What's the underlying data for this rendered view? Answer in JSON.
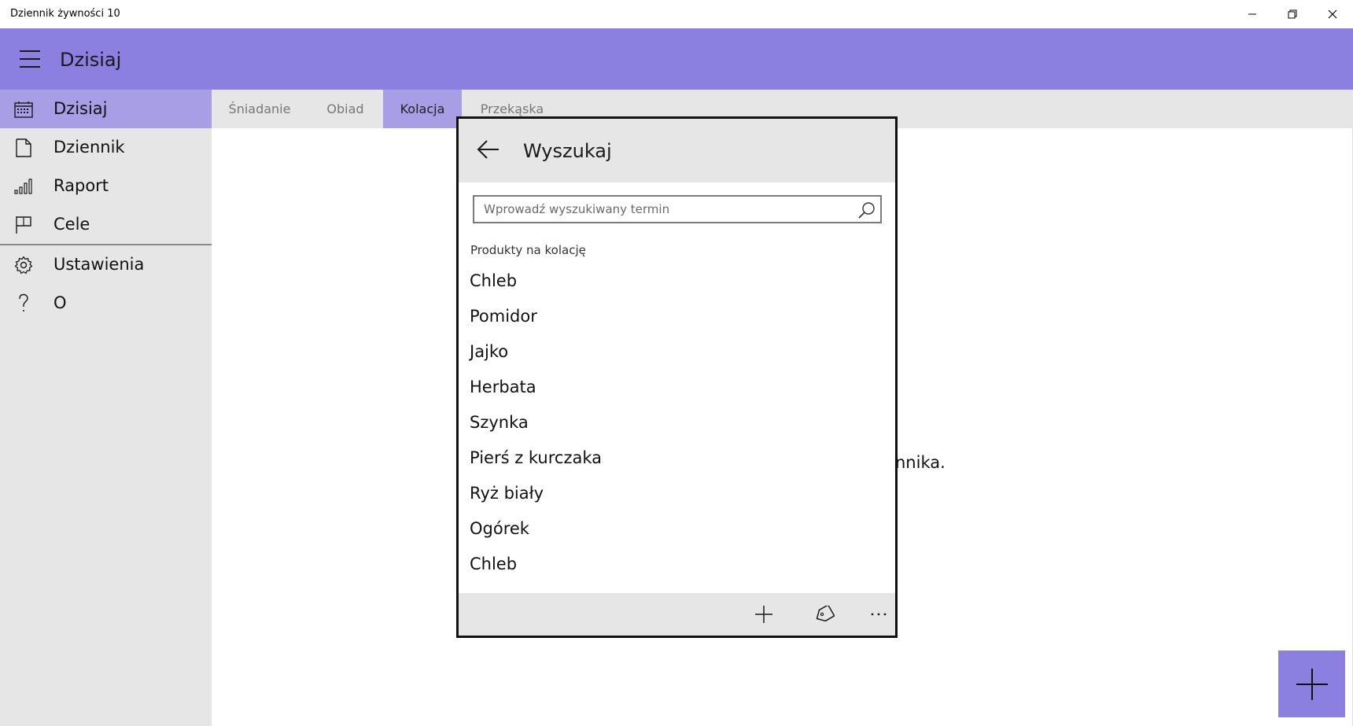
{
  "window": {
    "title": "Dziennik żywności 10",
    "minimize_icon": "minimize-icon",
    "maximize_icon": "restore-icon",
    "close_icon": "close-icon"
  },
  "header": {
    "menu_icon": "hamburger-icon",
    "title": "Dzisiaj",
    "accent_color": "#8b80e0"
  },
  "sidebar": {
    "items": [
      {
        "label": "Dzisiaj",
        "icon": "calendar-icon",
        "active": true
      },
      {
        "label": "Dziennik",
        "icon": "document-icon",
        "active": false
      },
      {
        "label": "Raport",
        "icon": "bar-chart-icon",
        "active": false
      },
      {
        "label": "Cele",
        "icon": "flag-icon",
        "active": false
      },
      {
        "label": "Ustawienia",
        "icon": "gear-icon",
        "active": false
      },
      {
        "label": "O",
        "icon": "question-icon",
        "active": false
      }
    ]
  },
  "tabs": [
    {
      "label": "Śniadanie",
      "active": false
    },
    {
      "label": "Obiad",
      "active": false
    },
    {
      "label": "Kolacja",
      "active": true
    },
    {
      "label": "Przekąska",
      "active": false
    }
  ],
  "main": {
    "empty_text_fragment": "nnika."
  },
  "fab": {
    "icon": "plus-icon"
  },
  "search_dialog": {
    "back_icon": "back-arrow-icon",
    "title": "Wyszukaj",
    "search": {
      "placeholder": "Wprowadź wyszukiwany termin",
      "value": "",
      "icon": "search-icon"
    },
    "section_label": "Produkty na kolację",
    "products": [
      "Chleb",
      "Pomidor",
      "Jajko",
      "Herbata",
      "Szynka",
      "Pierś z kurczaka",
      "Ryż biały",
      "Ogórek",
      "Chleb"
    ],
    "footer": {
      "add_icon": "plus-icon",
      "tag_icon": "tag-icon",
      "more_icon": "more-icon"
    }
  }
}
